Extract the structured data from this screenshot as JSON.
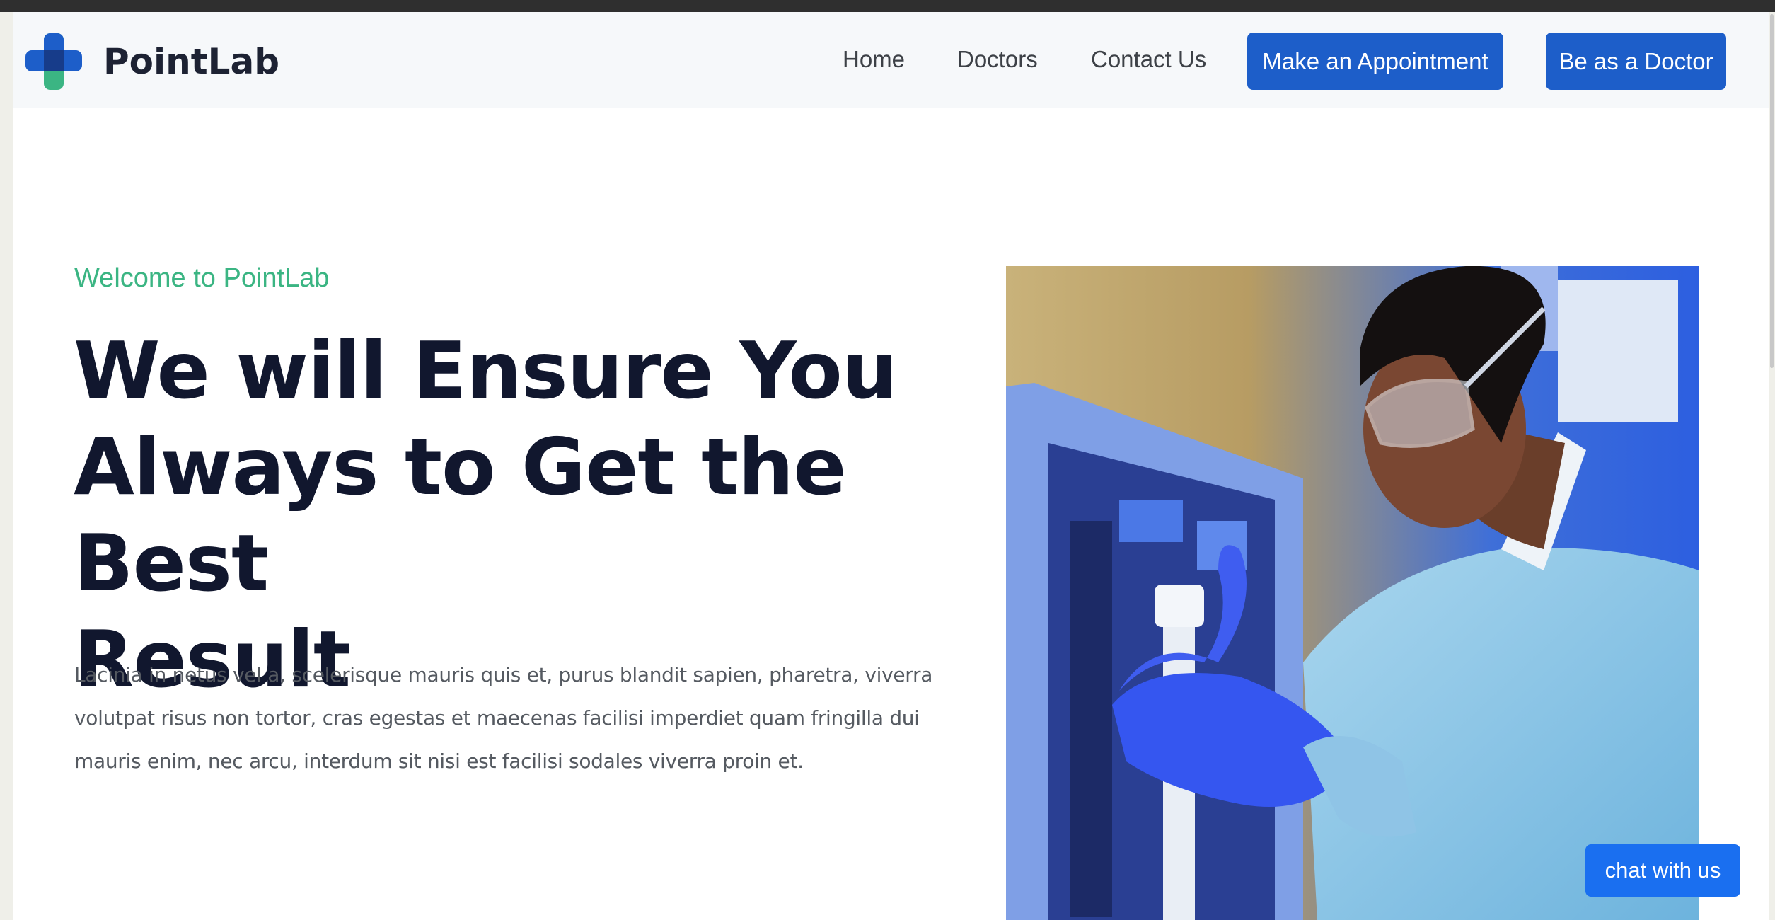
{
  "brand": {
    "name": "PointLab",
    "colors": {
      "blue": "#1d5ec9",
      "green": "#3bb583",
      "navy": "#11172e"
    }
  },
  "nav": {
    "links": [
      "Home",
      "Doctors",
      "Contact Us"
    ],
    "appointment_label": "Make an Appointment",
    "doctor_label": "Be as a Doctor"
  },
  "hero": {
    "welcome": "Welcome to PointLab",
    "headline_lines": [
      "We will Ensure You",
      "Always to Get the Best",
      "Result"
    ],
    "intro_lines": [
      "Lacinia in netus vel a, scelerisque mauris quis et, purus blandit sapien, pharetra, viverra",
      "volutpat risus non tortor, cras egestas et maecenas facilisi imperdiet quam fringilla dui",
      "mauris enim, nec arcu, interdum sit nisi est facilisi sodales viverra proin et."
    ],
    "image_icon": "lab-scientist-photo"
  },
  "chat": {
    "label": "chat with us"
  }
}
